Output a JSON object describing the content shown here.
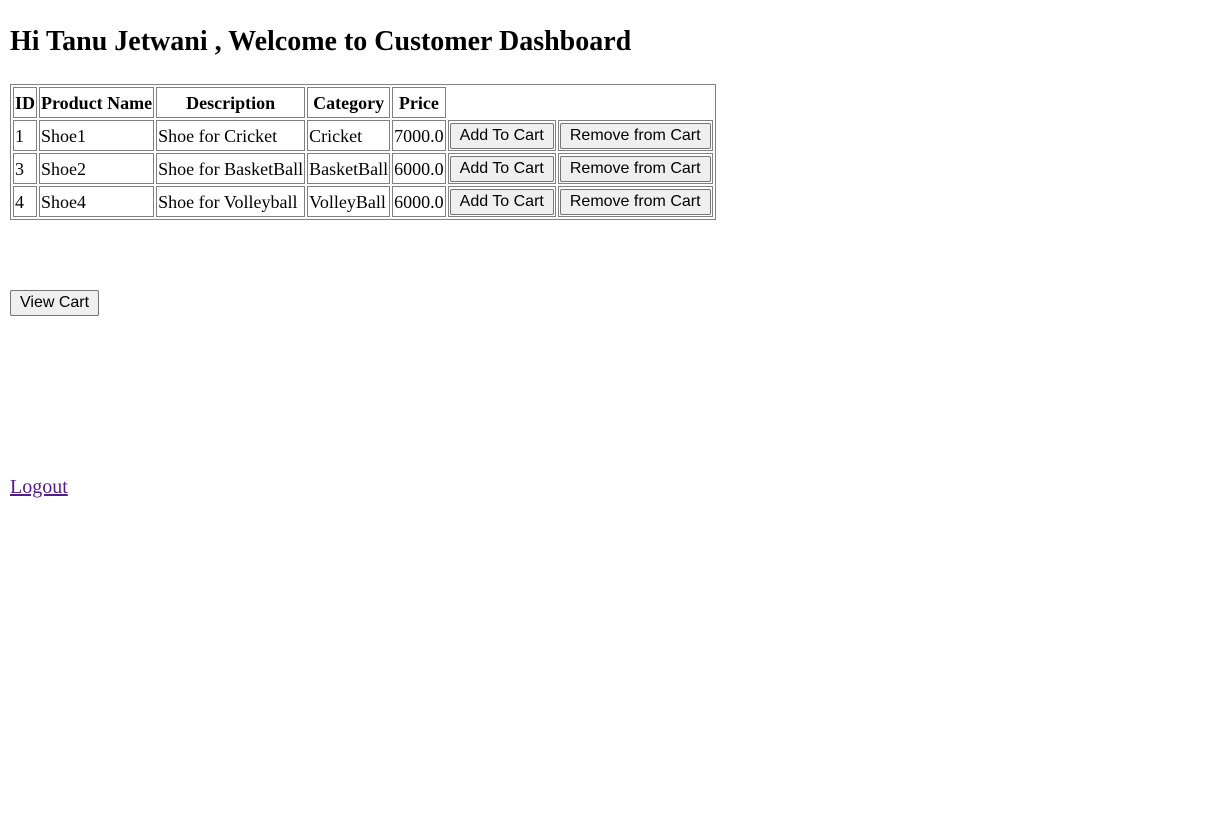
{
  "page": {
    "title": "Hi Tanu Jetwani , Welcome to Customer Dashboard"
  },
  "table": {
    "headers": {
      "id": "ID",
      "name": "Product Name",
      "description": "Description",
      "category": "Category",
      "price": "Price"
    },
    "rows": [
      {
        "id": "1",
        "name": "Shoe1",
        "description": "Shoe for Cricket",
        "category": "Cricket",
        "price": "7000.0",
        "add_label": "Add To Cart",
        "remove_label": "Remove from Cart"
      },
      {
        "id": "3",
        "name": "Shoe2",
        "description": "Shoe for BasketBall",
        "category": "BasketBall",
        "price": "6000.0",
        "add_label": "Add To Cart",
        "remove_label": "Remove from Cart"
      },
      {
        "id": "4",
        "name": "Shoe4",
        "description": "Shoe for Volleyball",
        "category": "VolleyBall",
        "price": "6000.0",
        "add_label": "Add To Cart",
        "remove_label": "Remove from Cart"
      }
    ]
  },
  "actions": {
    "view_cart_label": "View Cart",
    "logout_label": "Logout"
  },
  "colors": {
    "link_visited": "#551a8b",
    "button_bg": "#efefef",
    "border": "#808080"
  }
}
